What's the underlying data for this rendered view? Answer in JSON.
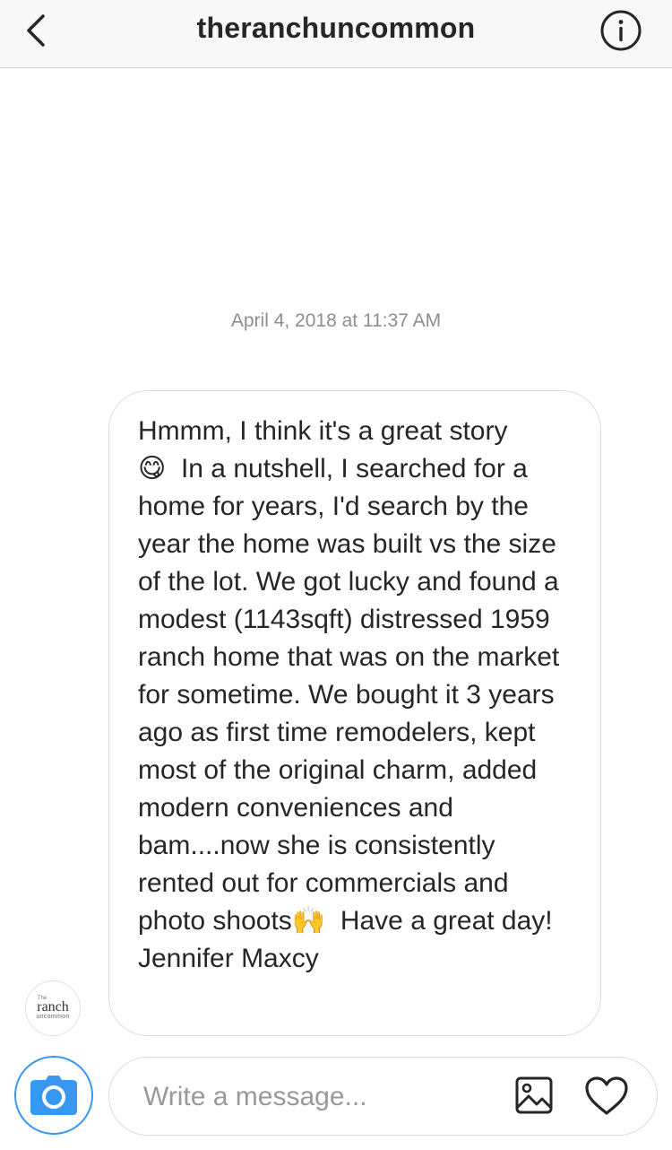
{
  "header": {
    "title": "theranchuncommon",
    "back_icon": "chevron-left-icon",
    "info_icon": "info-circle-icon"
  },
  "thread": {
    "timestamp": "April 4, 2018 at 11:37 AM",
    "message": {
      "text_part1": "Hmmm, I think it's a great story\n",
      "emoji1": "😋",
      "text_part2": "  In a nutshell, I searched for a home for years, I'd search by the year the home was built vs the size of the lot. We got lucky and found a modest (1143sqft) distressed 1959 ranch home that was on the market for sometime. We bought it 3 years ago as first time remodelers, kept most of the original charm, added modern conveniences and bam....now she is consistently rented out for commercials and photo shoots",
      "emoji2": "🙌",
      "text_part3": "  Have a great day! Jennifer Maxcy"
    },
    "avatar": {
      "line1": "The",
      "line2": "ranch",
      "line3": "uncommon"
    }
  },
  "composer": {
    "placeholder": "Write a message...",
    "camera_icon": "camera-icon",
    "gallery_icon": "image-gallery-icon",
    "like_icon": "heart-icon"
  },
  "colors": {
    "accent": "#3897f0",
    "text": "#262626",
    "muted": "#8e8e8e",
    "border": "#dbdbdb",
    "header_bg": "#f8f8f8"
  }
}
